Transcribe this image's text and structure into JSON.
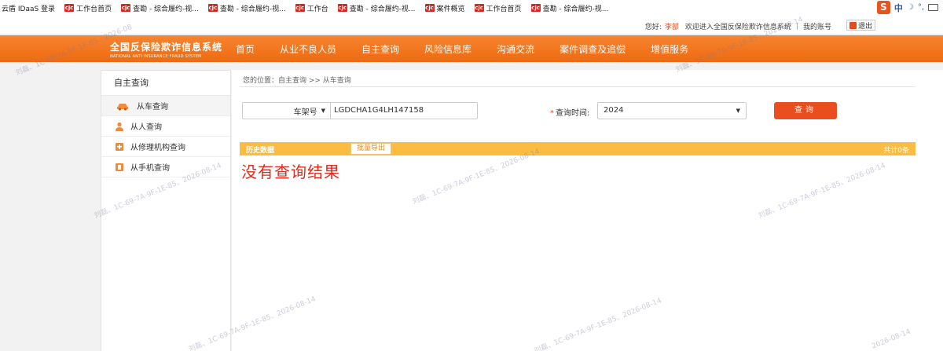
{
  "bookmarks": [
    {
      "label": "云盾 IDaaS 登录",
      "logo": ""
    },
    {
      "label": "工作台首页",
      "logo": "cjc"
    },
    {
      "label": "查勘 - 综合履约-视...",
      "logo": "cjc"
    },
    {
      "label": "查勘 - 综合履约-视...",
      "logo": "cjc"
    },
    {
      "label": "工作台",
      "logo": "cjc"
    },
    {
      "label": "查勘 - 综合履约-视...",
      "logo": "cjc"
    },
    {
      "label": "案件概览",
      "logo": "cjc"
    },
    {
      "label": "工作台首页",
      "logo": "cjc"
    },
    {
      "label": "查勘 - 综合履约-视...",
      "logo": "cjc"
    }
  ],
  "ime": {
    "mode": "中"
  },
  "topinfo": {
    "greeting": "您好:",
    "user": "李部",
    "welcome": "欢迎进入全国反保险欺诈信息系统",
    "sep": "|",
    "account": "我的账号",
    "logout": "退出"
  },
  "brand": {
    "cn": "全国反保险欺诈信息系统",
    "en": "NATIONAL ANTI INSURANCE FRAUD SYSTEM"
  },
  "nav": [
    "首页",
    "从业不良人员",
    "自主查询",
    "风险信息库",
    "沟通交流",
    "案件调查及追偿",
    "增值服务"
  ],
  "sidebar": {
    "title": "自主查询",
    "items": [
      {
        "label": "从车查询",
        "icon": "car-icon"
      },
      {
        "label": "从人查询",
        "icon": "person-icon"
      },
      {
        "label": "从修理机构查询",
        "icon": "repair-shop-icon"
      },
      {
        "label": "从手机查询",
        "icon": "phone-icon"
      }
    ]
  },
  "main": {
    "breadcrumb": "您的位置：自主查询 >> 从车查询",
    "type_select": "车架号",
    "vin_value": "LGDCHA1G4LH147158",
    "time_label": "查询时间:",
    "time_star": "*",
    "year_value": "2024",
    "query_button": "查询",
    "history_title": "历史数据",
    "export_button": "批量导出",
    "history_count": "共计0条",
    "no_result": "没有查询结果"
  },
  "watermark": {
    "text1": "刘磊、1C-69-7A-9F-1E-85、2026-08-14",
    "text2": "刘磊、1C-69-7A-9F-1E-85、2026-08",
    "text3": "2026-08-14",
    "text4": "刘磊、1C-69-7A-9F-1E-85、2026-08-14"
  },
  "colors": {
    "nav_orange": "#ee6a12",
    "accent_red": "#e84b1a",
    "history_bar": "#fcbc41",
    "no_result": "#e32a1d"
  }
}
